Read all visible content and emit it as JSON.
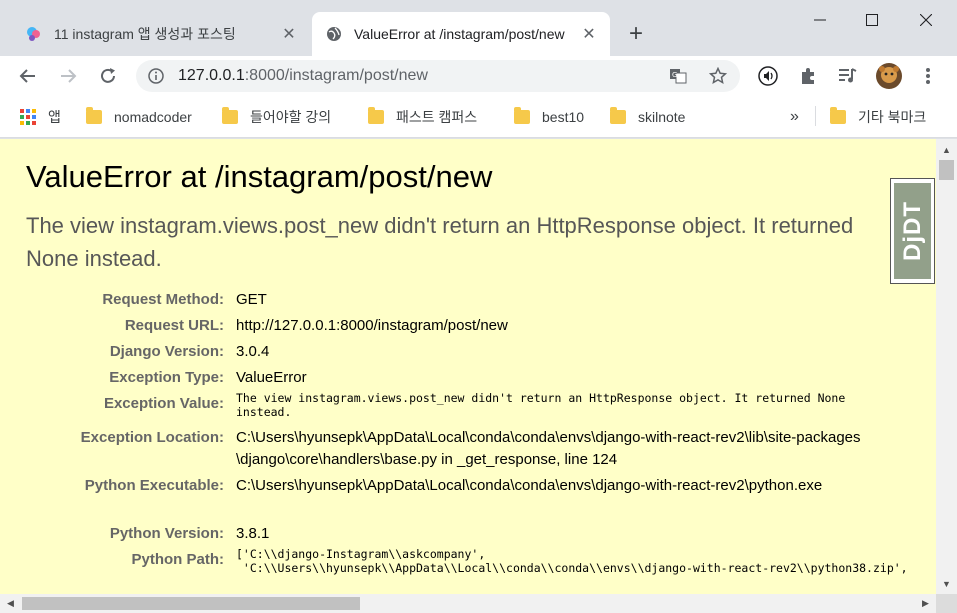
{
  "tabs": [
    {
      "label": "11 instagram 앱 생성과 포스팅 ",
      "active": false,
      "close": "✕"
    },
    {
      "label": "ValueError at /instagram/post/new",
      "active": true,
      "close": "✕"
    }
  ],
  "new_tab": "+",
  "toolbar": {
    "url_host": "127.0.0.1",
    "url_rest": ":8000/instagram/post/new"
  },
  "bookmarks": {
    "apps_label": "앱",
    "items": [
      "nomadcoder",
      "들어야할 강의",
      "패스트 캠퍼스",
      "best10",
      "skilnote"
    ],
    "overflow": "»",
    "other": "기타 북마크"
  },
  "error": {
    "title": "ValueError at /instagram/post/new",
    "summary": "The view instagram.views.post_new didn't return an HttpResponse object. It returned None instead.",
    "djdt": "DjDT",
    "meta": [
      {
        "key": "Request Method:",
        "value": "GET"
      },
      {
        "key": "Request URL:",
        "value": "http://127.0.0.1:8000/instagram/post/new"
      },
      {
        "key": "Django Version:",
        "value": "3.0.4"
      },
      {
        "key": "Exception Type:",
        "value": "ValueError"
      },
      {
        "key": "Exception Value:",
        "value": "The view instagram.views.post_new didn't return an HttpResponse object. It returned None instead."
      },
      {
        "key": "Exception Location:",
        "value": "C:\\Users\\hyunsepk\\AppData\\Local\\conda\\conda\\envs\\django-with-react-rev2\\lib\\site-packages\\django\\core\\handlers\\base.py in _get_response, line 124"
      },
      {
        "key": "Python Executable:",
        "value": "C:\\Users\\hyunsepk\\AppData\\Local\\conda\\conda\\envs\\django-with-react-rev2\\python.exe"
      },
      {
        "key": "Python Version:",
        "value": "3.8.1"
      },
      {
        "key": "Python Path:",
        "value": "['C:\\\\django-Instagram\\\\askcompany',\n 'C:\\\\Users\\\\hyunsepk\\\\AppData\\\\Local\\\\conda\\\\conda\\\\envs\\\\django-with-react-rev2\\\\python38.zip',"
      }
    ]
  },
  "colors": {
    "page_bg": "#ffffc8",
    "meta_key": "#666666",
    "chrome_bg": "#dee1e6",
    "djdt_green": "#92a08a"
  }
}
